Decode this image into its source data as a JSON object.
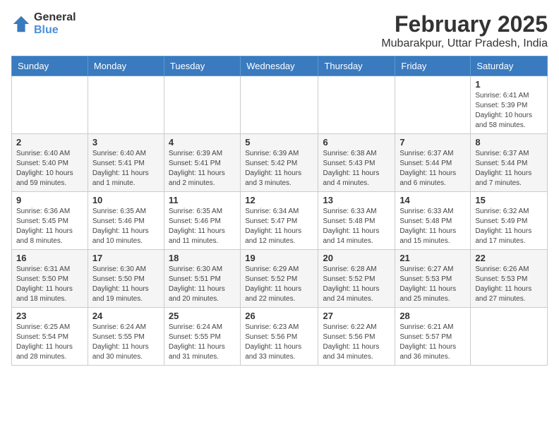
{
  "logo": {
    "general": "General",
    "blue": "Blue"
  },
  "title": "February 2025",
  "subtitle": "Mubarakpur, Uttar Pradesh, India",
  "weekdays": [
    "Sunday",
    "Monday",
    "Tuesday",
    "Wednesday",
    "Thursday",
    "Friday",
    "Saturday"
  ],
  "weeks": [
    [
      {
        "day": "",
        "info": ""
      },
      {
        "day": "",
        "info": ""
      },
      {
        "day": "",
        "info": ""
      },
      {
        "day": "",
        "info": ""
      },
      {
        "day": "",
        "info": ""
      },
      {
        "day": "",
        "info": ""
      },
      {
        "day": "1",
        "info": "Sunrise: 6:41 AM\nSunset: 5:39 PM\nDaylight: 10 hours and 58 minutes."
      }
    ],
    [
      {
        "day": "2",
        "info": "Sunrise: 6:40 AM\nSunset: 5:40 PM\nDaylight: 10 hours and 59 minutes."
      },
      {
        "day": "3",
        "info": "Sunrise: 6:40 AM\nSunset: 5:41 PM\nDaylight: 11 hours and 1 minute."
      },
      {
        "day": "4",
        "info": "Sunrise: 6:39 AM\nSunset: 5:41 PM\nDaylight: 11 hours and 2 minutes."
      },
      {
        "day": "5",
        "info": "Sunrise: 6:39 AM\nSunset: 5:42 PM\nDaylight: 11 hours and 3 minutes."
      },
      {
        "day": "6",
        "info": "Sunrise: 6:38 AM\nSunset: 5:43 PM\nDaylight: 11 hours and 4 minutes."
      },
      {
        "day": "7",
        "info": "Sunrise: 6:37 AM\nSunset: 5:44 PM\nDaylight: 11 hours and 6 minutes."
      },
      {
        "day": "8",
        "info": "Sunrise: 6:37 AM\nSunset: 5:44 PM\nDaylight: 11 hours and 7 minutes."
      }
    ],
    [
      {
        "day": "9",
        "info": "Sunrise: 6:36 AM\nSunset: 5:45 PM\nDaylight: 11 hours and 8 minutes."
      },
      {
        "day": "10",
        "info": "Sunrise: 6:35 AM\nSunset: 5:46 PM\nDaylight: 11 hours and 10 minutes."
      },
      {
        "day": "11",
        "info": "Sunrise: 6:35 AM\nSunset: 5:46 PM\nDaylight: 11 hours and 11 minutes."
      },
      {
        "day": "12",
        "info": "Sunrise: 6:34 AM\nSunset: 5:47 PM\nDaylight: 11 hours and 12 minutes."
      },
      {
        "day": "13",
        "info": "Sunrise: 6:33 AM\nSunset: 5:48 PM\nDaylight: 11 hours and 14 minutes."
      },
      {
        "day": "14",
        "info": "Sunrise: 6:33 AM\nSunset: 5:48 PM\nDaylight: 11 hours and 15 minutes."
      },
      {
        "day": "15",
        "info": "Sunrise: 6:32 AM\nSunset: 5:49 PM\nDaylight: 11 hours and 17 minutes."
      }
    ],
    [
      {
        "day": "16",
        "info": "Sunrise: 6:31 AM\nSunset: 5:50 PM\nDaylight: 11 hours and 18 minutes."
      },
      {
        "day": "17",
        "info": "Sunrise: 6:30 AM\nSunset: 5:50 PM\nDaylight: 11 hours and 19 minutes."
      },
      {
        "day": "18",
        "info": "Sunrise: 6:30 AM\nSunset: 5:51 PM\nDaylight: 11 hours and 20 minutes."
      },
      {
        "day": "19",
        "info": "Sunrise: 6:29 AM\nSunset: 5:52 PM\nDaylight: 11 hours and 22 minutes."
      },
      {
        "day": "20",
        "info": "Sunrise: 6:28 AM\nSunset: 5:52 PM\nDaylight: 11 hours and 24 minutes."
      },
      {
        "day": "21",
        "info": "Sunrise: 6:27 AM\nSunset: 5:53 PM\nDaylight: 11 hours and 25 minutes."
      },
      {
        "day": "22",
        "info": "Sunrise: 6:26 AM\nSunset: 5:53 PM\nDaylight: 11 hours and 27 minutes."
      }
    ],
    [
      {
        "day": "23",
        "info": "Sunrise: 6:25 AM\nSunset: 5:54 PM\nDaylight: 11 hours and 28 minutes."
      },
      {
        "day": "24",
        "info": "Sunrise: 6:24 AM\nSunset: 5:55 PM\nDaylight: 11 hours and 30 minutes."
      },
      {
        "day": "25",
        "info": "Sunrise: 6:24 AM\nSunset: 5:55 PM\nDaylight: 11 hours and 31 minutes."
      },
      {
        "day": "26",
        "info": "Sunrise: 6:23 AM\nSunset: 5:56 PM\nDaylight: 11 hours and 33 minutes."
      },
      {
        "day": "27",
        "info": "Sunrise: 6:22 AM\nSunset: 5:56 PM\nDaylight: 11 hours and 34 minutes."
      },
      {
        "day": "28",
        "info": "Sunrise: 6:21 AM\nSunset: 5:57 PM\nDaylight: 11 hours and 36 minutes."
      },
      {
        "day": "",
        "info": ""
      }
    ]
  ]
}
